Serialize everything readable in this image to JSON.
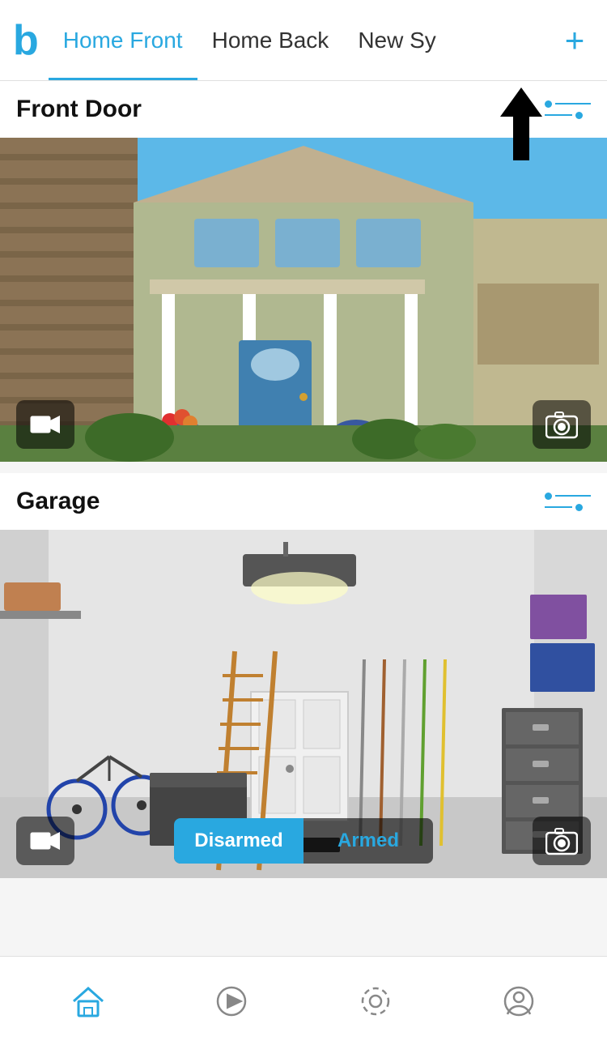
{
  "header": {
    "logo": "b",
    "tabs": [
      {
        "id": "home-front",
        "label": "Home Front",
        "active": true
      },
      {
        "id": "home-back",
        "label": "Home Back",
        "active": false
      },
      {
        "id": "new-sy",
        "label": "New Sy",
        "active": false
      }
    ],
    "add_button_label": "+"
  },
  "cameras": [
    {
      "id": "front-door",
      "title": "Front Door",
      "has_arm_toggle": false,
      "video_btn_label": "video",
      "camera_btn_label": "camera"
    },
    {
      "id": "garage",
      "title": "Garage",
      "has_arm_toggle": true,
      "arm_options": [
        {
          "label": "Disarmed",
          "active": true
        },
        {
          "label": "Armed",
          "active": false
        }
      ],
      "video_btn_label": "video",
      "camera_btn_label": "camera"
    }
  ],
  "bottom_nav": [
    {
      "id": "home",
      "icon": "home-icon",
      "active": true
    },
    {
      "id": "play",
      "icon": "play-icon",
      "active": false
    },
    {
      "id": "settings",
      "icon": "settings-icon",
      "active": false
    },
    {
      "id": "account",
      "icon": "account-icon",
      "active": false
    }
  ],
  "upload_arrow_visible": true
}
